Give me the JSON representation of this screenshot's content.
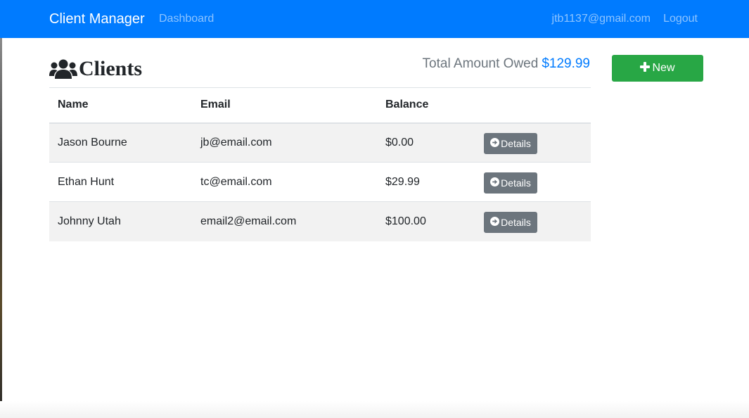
{
  "navbar": {
    "brand": "Client Manager",
    "links": [
      {
        "label": "Dashboard"
      }
    ],
    "user_email": "jtb1137@gmail.com",
    "logout_label": "Logout"
  },
  "heading": {
    "icon": "users-icon",
    "title": "Clients"
  },
  "summary": {
    "label": "Total Amount Owed",
    "value": "$129.99"
  },
  "actions": {
    "new_label": "New",
    "new_icon": "plus-icon"
  },
  "table": {
    "columns": [
      "Name",
      "Email",
      "Balance",
      ""
    ],
    "rows": [
      {
        "name": "Jason Bourne",
        "email": "jb@email.com",
        "balance": "$0.00",
        "action": "Details"
      },
      {
        "name": "Ethan Hunt",
        "email": "tc@email.com",
        "balance": "$29.99",
        "action": "Details"
      },
      {
        "name": "Johnny Utah",
        "email": "email2@email.com",
        "balance": "$100.00",
        "action": "Details"
      }
    ]
  },
  "colors": {
    "primary": "#007bff",
    "success": "#28a745",
    "secondary": "#6c757d",
    "stripe": "#f2f2f2"
  }
}
